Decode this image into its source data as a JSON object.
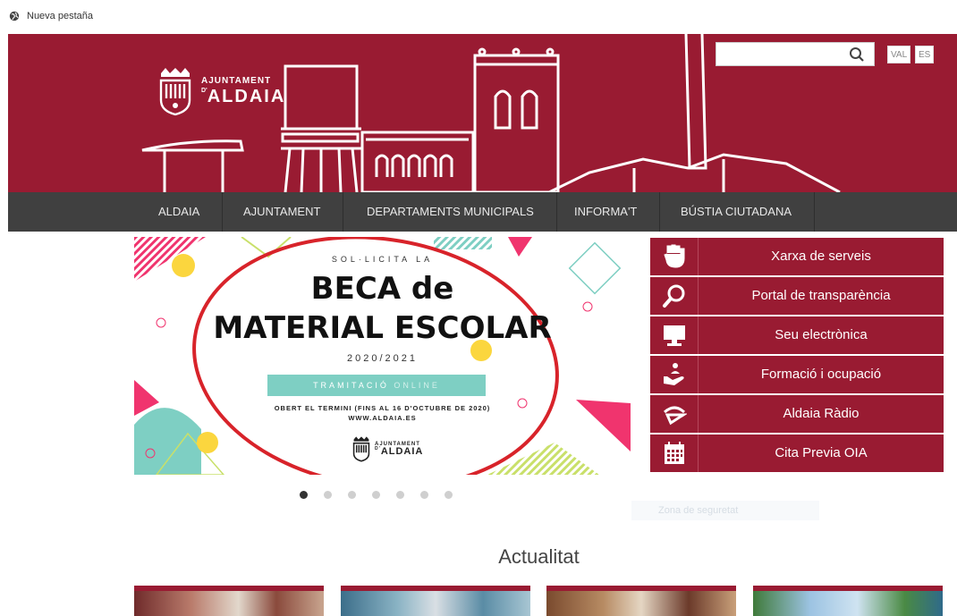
{
  "browser": {
    "tab_title": "Nueva pestaña",
    "tab_icon": "globe-icon"
  },
  "header": {
    "logo_top": "AJUNTAMENT",
    "logo_prefix": "D'",
    "logo_bottom": "ALDAIA",
    "search_placeholder": "",
    "languages": [
      "VAL",
      "ES"
    ]
  },
  "nav": {
    "items": [
      "ALDAIA",
      "AJUNTAMENT",
      "DEPARTAMENTS MUNICIPALS",
      "INFORMA'T",
      "BÚSTIA CIUTADANA"
    ]
  },
  "banner": {
    "subtitle": "SOL·LICITA LA",
    "title_line1": "BECA de",
    "title_line2": "MATERIAL ESCOLAR",
    "year": "2020/2021",
    "button_main": "TRAMITACIÓ",
    "button_accent": "ONLINE",
    "info_line1": "OBERT EL TERMINI (FINS AL 16 D'OCTUBRE DE 2020)",
    "info_line2": "WWW.ALDAIA.ES",
    "logo_top": "AJUNTAMENT",
    "logo_prefix": "D'",
    "logo_bottom": "ALDAIA"
  },
  "slider": {
    "count": 7,
    "active": 1
  },
  "services": [
    {
      "label": "Xarxa de serveis",
      "icon": "hand-icon"
    },
    {
      "label": "Portal de transparència",
      "icon": "magnifier-icon"
    },
    {
      "label": "Seu electrònica",
      "icon": "monitor-icon"
    },
    {
      "label": "Formació i ocupació",
      "icon": "people-hand-icon"
    },
    {
      "label": "Aldaia Ràdio",
      "icon": "radio-icon"
    },
    {
      "label": "Cita Previa OIA",
      "icon": "calendar-icon"
    }
  ],
  "faint_text": "Zona de seguretat",
  "section": {
    "title": "Actualitat"
  },
  "colors": {
    "brand": "#991b32",
    "nav": "#404040",
    "teal": "#7ecfc3",
    "pink": "#f0346e",
    "yellow": "#fbd63e"
  }
}
